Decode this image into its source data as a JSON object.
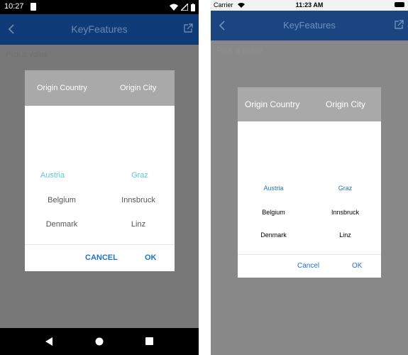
{
  "android": {
    "status": {
      "time": "10:27"
    },
    "toolbar": {
      "title": "KeyFeatures"
    },
    "placeholder": "Pick a value",
    "dialog": {
      "headers": [
        "Origin Country",
        "Origin City"
      ],
      "countries": [
        "Austria",
        "Belgium",
        "Denmark"
      ],
      "cities": [
        "Graz",
        "Innsbruck",
        "Linz"
      ],
      "selected_color": "#5ecbd0",
      "cancel": "CANCEL",
      "ok": "OK"
    }
  },
  "ios": {
    "status": {
      "carrier": "Carrier",
      "time": "11:23 AM"
    },
    "toolbar": {
      "title": "KeyFeatures"
    },
    "placeholder": "Pick a value",
    "dialog": {
      "headers": [
        "Origin Country",
        "Origin City"
      ],
      "countries": [
        "Austria",
        "Belgium",
        "Denmark"
      ],
      "cities": [
        "Graz",
        "Innsbruck",
        "Linz"
      ],
      "selected_color": "#1e73c8",
      "cancel": "Cancel",
      "ok": "OK"
    }
  },
  "colors": {
    "android_toolbar": "#0f3c78",
    "ios_toolbar": "#1a4580",
    "dialog_header": "#a9a9a9",
    "button_blue": "#1e73c8"
  },
  "icons": [
    "back-chevron-icon",
    "external-link-icon",
    "wifi-icon",
    "signal-icon",
    "battery-icon",
    "nav-back-icon",
    "nav-home-icon",
    "nav-recents-icon"
  ]
}
